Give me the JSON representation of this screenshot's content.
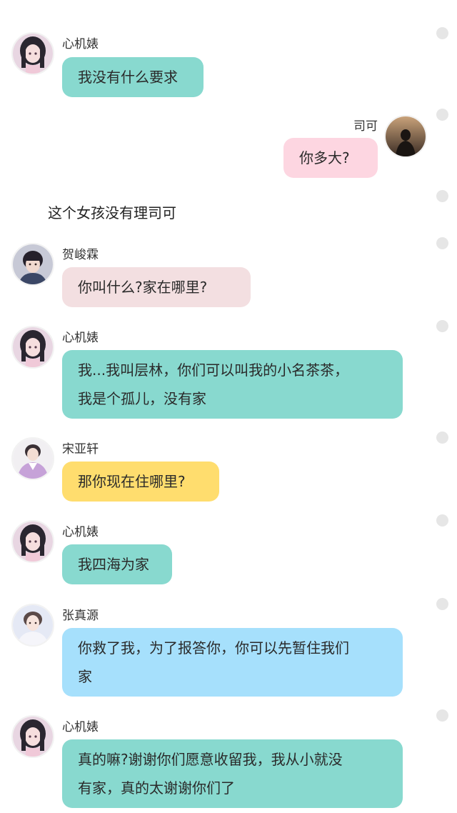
{
  "colors": {
    "xinjibiao_bubble": "#88d9cf",
    "siké_bubble": "#fdd6e1",
    "hejunlin_bubble": "#f3dfe1",
    "songyaxuan_bubble": "#ffdd6e",
    "zhangzhenyuan_bubble": "#a6e0fc"
  },
  "messages": [
    {
      "speaker": "心机婊",
      "avatar_icon": "girl-avatar-icon",
      "text": "我没有什么要求"
    },
    {
      "speaker": "司可",
      "avatar_icon": "dark-silhouette-avatar-icon",
      "text": "你多大?"
    },
    {
      "narration": "这个女孩没有理司可"
    },
    {
      "speaker": "贺峻霖",
      "avatar_icon": "boy-avatar-icon",
      "text": "你叫什么?家在哪里?"
    },
    {
      "speaker": "心机婊",
      "avatar_icon": "girl-avatar-icon",
      "text": "我...我叫层林，你们可以叫我的小名茶茶，\n我是个孤儿，没有家"
    },
    {
      "speaker": "宋亚轩",
      "avatar_icon": "boy-purple-avatar-icon",
      "text": "那你现在住哪里?"
    },
    {
      "speaker": "心机婊",
      "avatar_icon": "girl-avatar-icon",
      "text": "我四海为家"
    },
    {
      "speaker": "张真源",
      "avatar_icon": "boy-light-avatar-icon",
      "text": "你救了我，为了报答你，你可以先暂住我们\n家"
    },
    {
      "speaker": "心机婊",
      "avatar_icon": "girl-avatar-icon",
      "text": "真的嘛?谢谢你们愿意收留我，我从小就没\n有家，真的太谢谢你们了"
    }
  ]
}
